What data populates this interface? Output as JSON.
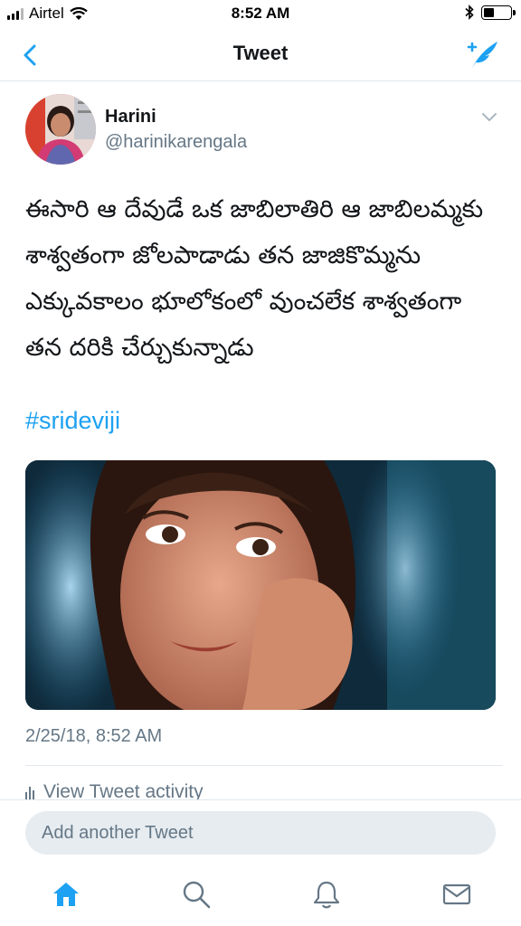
{
  "status_bar": {
    "carrier": "Airtel",
    "time": "8:52 AM",
    "battery_level": 0.4
  },
  "nav": {
    "title": "Tweet",
    "back_icon": "chevron-left-icon",
    "compose_icon": "compose-tweet-icon"
  },
  "tweet": {
    "author_name": "Harini",
    "author_handle": "@harinikarengala",
    "text": "ఈసారి ఆ దేవుడే ఒక జాబిలాతిరి ఆ జాబిలమ్మకు శాశ్వతంగా జోలపాడాడు తన జాజికొమ్మను ఎక్కువకాలం భూలోకంలో వుంచలేక శాశ్వతంగా తన దరికి చేర్చుకున్నాడు",
    "hashtag": "#srideviji",
    "timestamp": "2/25/18, 8:52 AM",
    "activity_label": "View Tweet activity"
  },
  "reply": {
    "placeholder": "Add another Tweet"
  },
  "tabbar": {
    "items": [
      "home-icon",
      "search-icon",
      "notifications-icon",
      "messages-icon"
    ]
  },
  "colors": {
    "accent": "#1da1f2",
    "secondary_text": "#657786",
    "divider": "#e1e8ed",
    "reply_box": "#e6ecf0"
  }
}
